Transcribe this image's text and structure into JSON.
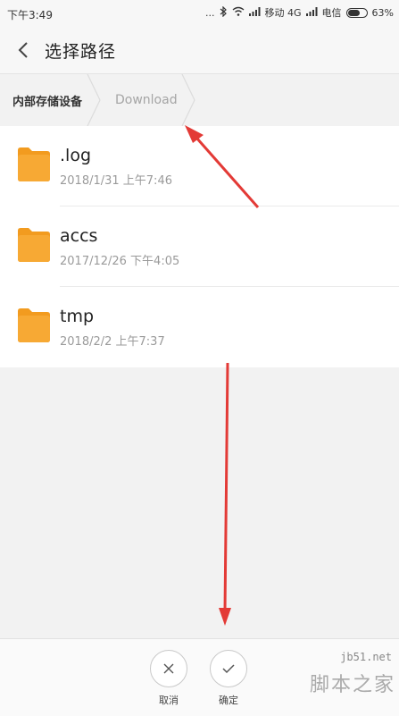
{
  "status_bar": {
    "time": "下午3:49",
    "signal_dots": "...",
    "network_1": "移动 4G",
    "network_2": "电信",
    "battery": "63%",
    "battery_level": 0.63
  },
  "header": {
    "title": "选择路径"
  },
  "breadcrumb": {
    "root": "内部存储设备",
    "current": "Download"
  },
  "folders": [
    {
      "name": ".log",
      "date": "2018/1/31 上午7:46"
    },
    {
      "name": "accs",
      "date": "2017/12/26 下午4:05"
    },
    {
      "name": "tmp",
      "date": "2018/2/2 上午7:37"
    }
  ],
  "actions": {
    "cancel_label": "取消",
    "confirm_label": "确定"
  },
  "watermark": {
    "site": "jb51.net",
    "logo": "脚本之家"
  },
  "colors": {
    "folder": "#F7A934",
    "folder_tab": "#F29B1F",
    "annotation_arrow": "#E33A36"
  }
}
